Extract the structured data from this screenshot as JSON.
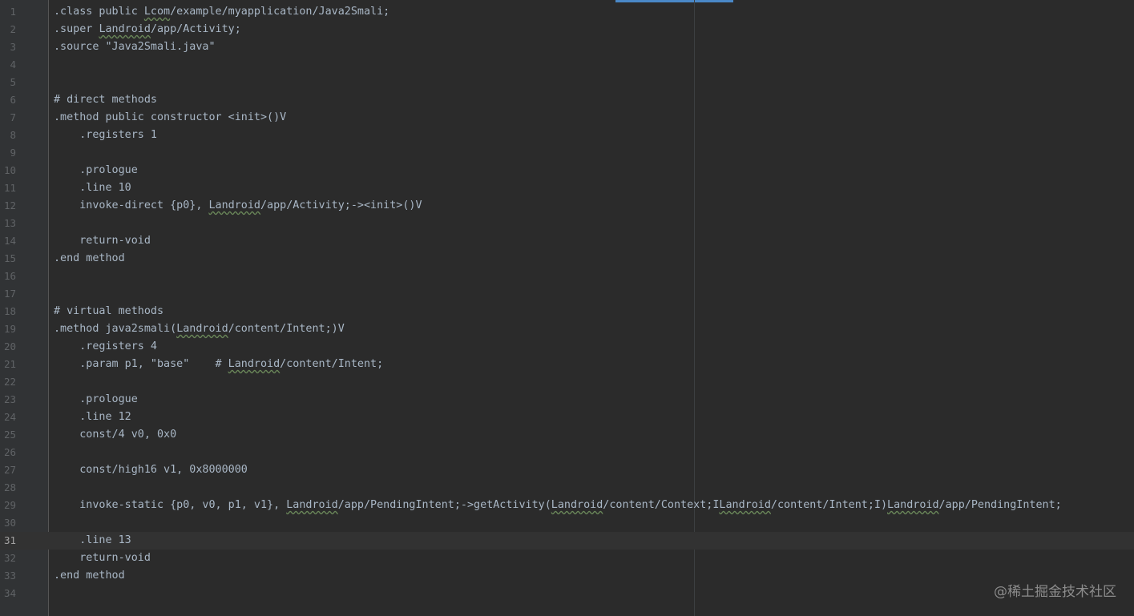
{
  "editor": {
    "current_line": 31,
    "lines": [
      {
        "n": "1",
        "text": ".class public Lcom/example/myapplication/Java2Smali;"
      },
      {
        "n": "2",
        "text": ".super Landroid/app/Activity;"
      },
      {
        "n": "3",
        "text": ".source \"Java2Smali.java\""
      },
      {
        "n": "4",
        "text": ""
      },
      {
        "n": "5",
        "text": ""
      },
      {
        "n": "6",
        "text": "# direct methods"
      },
      {
        "n": "7",
        "text": ".method public constructor <init>()V"
      },
      {
        "n": "8",
        "text": "    .registers 1"
      },
      {
        "n": "9",
        "text": ""
      },
      {
        "n": "10",
        "text": "    .prologue"
      },
      {
        "n": "11",
        "text": "    .line 10"
      },
      {
        "n": "12",
        "text": "    invoke-direct {p0}, Landroid/app/Activity;-><init>()V"
      },
      {
        "n": "13",
        "text": ""
      },
      {
        "n": "14",
        "text": "    return-void"
      },
      {
        "n": "15",
        "text": ".end method"
      },
      {
        "n": "16",
        "text": ""
      },
      {
        "n": "17",
        "text": ""
      },
      {
        "n": "18",
        "text": "# virtual methods"
      },
      {
        "n": "19",
        "text": ".method java2smali(Landroid/content/Intent;)V"
      },
      {
        "n": "20",
        "text": "    .registers 4"
      },
      {
        "n": "21",
        "text": "    .param p1, \"base\"    # Landroid/content/Intent;"
      },
      {
        "n": "22",
        "text": ""
      },
      {
        "n": "23",
        "text": "    .prologue"
      },
      {
        "n": "24",
        "text": "    .line 12"
      },
      {
        "n": "25",
        "text": "    const/4 v0, 0x0"
      },
      {
        "n": "26",
        "text": ""
      },
      {
        "n": "27",
        "text": "    const/high16 v1, 0x8000000"
      },
      {
        "n": "28",
        "text": ""
      },
      {
        "n": "29",
        "text": "    invoke-static {p0, v0, p1, v1}, Landroid/app/PendingIntent;->getActivity(Landroid/content/Context;ILandroid/content/Intent;I)Landroid/app/PendingIntent;"
      },
      {
        "n": "30",
        "text": ""
      },
      {
        "n": "31",
        "text": "    .line 13"
      },
      {
        "n": "32",
        "text": "    return-void"
      },
      {
        "n": "33",
        "text": ".end method"
      },
      {
        "n": "34",
        "text": ""
      }
    ]
  },
  "watermark": "@稀土掘金技术社区",
  "colors": {
    "background": "#2b2b2b",
    "gutter": "#313335",
    "code_text": "#a9b7c6",
    "line_number": "#606366",
    "current_line": "#323232",
    "active_tab_indicator": "#4a88c7"
  }
}
